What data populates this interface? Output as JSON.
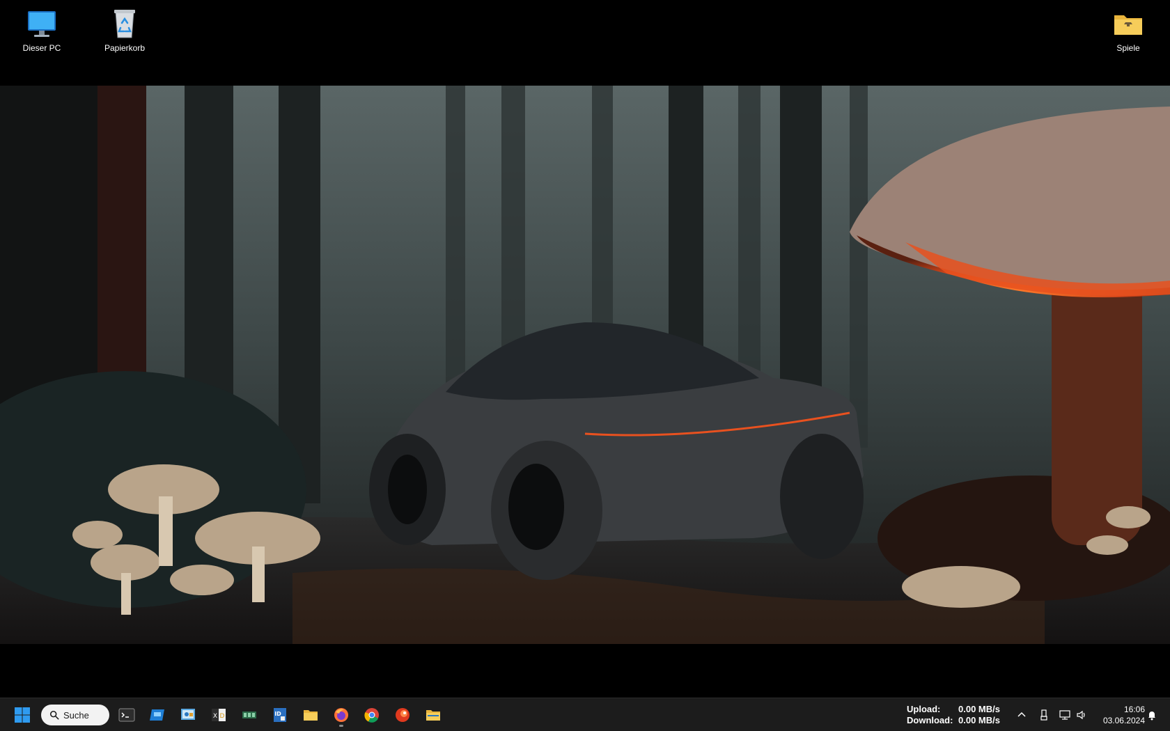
{
  "desktop": {
    "icons": [
      {
        "label": "Dieser PC",
        "icon": "monitor-icon"
      },
      {
        "label": "Papierkorb",
        "icon": "recycle-bin-icon"
      },
      {
        "label": "Spiele",
        "icon": "folder-icon"
      }
    ]
  },
  "taskbar": {
    "start_icon": "windows-start-icon",
    "search": {
      "label": "Suche",
      "icon": "search-icon"
    },
    "apps": [
      {
        "name": "terminal",
        "icon": "terminal-icon"
      },
      {
        "name": "app-blue",
        "icon": "app-window-icon"
      },
      {
        "name": "control-panel",
        "icon": "control-panel-icon"
      },
      {
        "name": "xd-app",
        "icon": "xd-app-icon"
      },
      {
        "name": "hardware-app",
        "icon": "chip-icon"
      },
      {
        "name": "id-app",
        "icon": "id-card-icon"
      },
      {
        "name": "file-explorer",
        "icon": "folder-icon"
      },
      {
        "name": "firefox",
        "icon": "firefox-icon",
        "active": true
      },
      {
        "name": "chrome",
        "icon": "chrome-icon"
      },
      {
        "name": "red-app",
        "icon": "red-circle-app-icon"
      },
      {
        "name": "folder-app",
        "icon": "folder-striped-icon"
      }
    ],
    "netspeed": {
      "upload_label": "Upload:",
      "upload_value": "0.00 MB/s",
      "download_label": "Download:",
      "download_value": "0.00 MB/s"
    },
    "tray_icons": [
      "chevron-up-icon",
      "usb-icon",
      "network-icon",
      "volume-icon"
    ],
    "clock": {
      "time": "16:06",
      "date": "03.06.2024"
    },
    "notification_icon": "bell-icon"
  },
  "colors": {
    "taskbar_bg": "#1c1c1c",
    "search_bg": "#f3f3f3",
    "start_blue": "#2f9bf0",
    "mushroom_glow": "#e8511f"
  }
}
